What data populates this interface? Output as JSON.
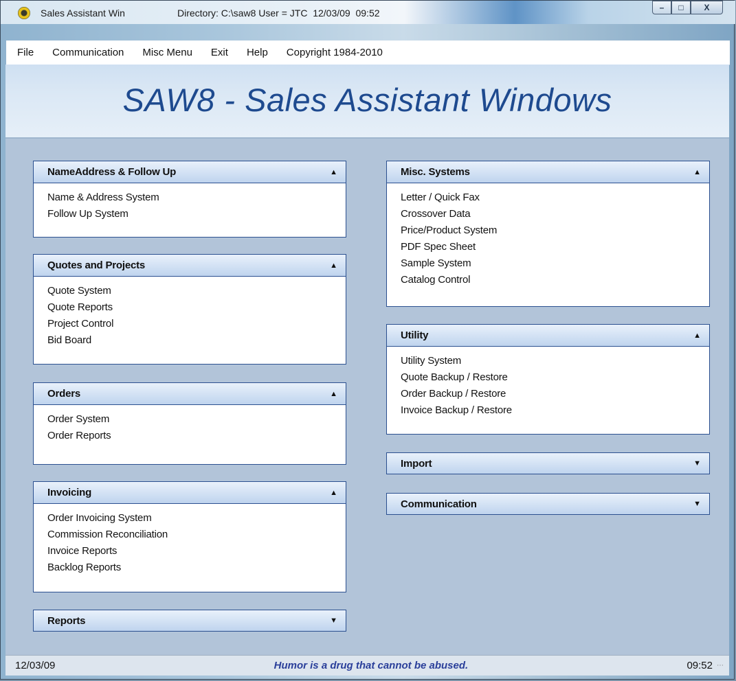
{
  "window": {
    "title": "Sales Assistant Win",
    "directory_info": "Directory: C:\\saw8 User = JTC  12/03/09  09:52",
    "minimize_symbol": "–",
    "maximize_symbol": "□",
    "close_symbol": "X"
  },
  "menu": {
    "items": [
      "File",
      "Communication",
      "Misc Menu",
      "Exit",
      "Help"
    ],
    "copyright": "Copyright 1984-2010"
  },
  "banner": {
    "title": "SAW8 - Sales Assistant Windows"
  },
  "left_panels": [
    {
      "title": "NameAddress & Follow Up",
      "arrow": "▲",
      "items": [
        "Name & Address System",
        "Follow Up System"
      ]
    },
    {
      "title": "Quotes and Projects",
      "arrow": "▲",
      "items": [
        "Quote System",
        "Quote Reports",
        "Project Control",
        "Bid Board"
      ]
    },
    {
      "title": "Orders",
      "arrow": "▲",
      "items": [
        "Order System",
        "Order Reports"
      ]
    },
    {
      "title": "Invoicing",
      "arrow": "▲",
      "items": [
        "Order Invoicing System",
        "Commission Reconciliation",
        "Invoice Reports",
        "Backlog Reports"
      ]
    },
    {
      "title": "Reports",
      "arrow": "▼",
      "items": []
    }
  ],
  "right_panels": [
    {
      "title": "Misc. Systems",
      "arrow": "▲",
      "items": [
        "Letter / Quick Fax",
        "Crossover Data",
        "Price/Product System",
        "PDF Spec Sheet",
        "Sample System",
        "Catalog Control"
      ]
    },
    {
      "title": "Utility",
      "arrow": "▲",
      "items": [
        "Utility System",
        "Quote Backup / Restore",
        "Order Backup / Restore",
        "Invoice Backup / Restore"
      ]
    },
    {
      "title": "Import",
      "arrow": "▼",
      "items": []
    },
    {
      "title": "Communication",
      "arrow": "▼",
      "items": []
    }
  ],
  "status": {
    "date": "12/03/09",
    "message": "Humor is a drug that cannot be abused.",
    "time": "09:52"
  },
  "colors": {
    "banner_text": "#1e4a8f",
    "panel_border": "#2a4f8f",
    "content_bg": "#b2c4d9",
    "status_message": "#2a3f9a"
  }
}
